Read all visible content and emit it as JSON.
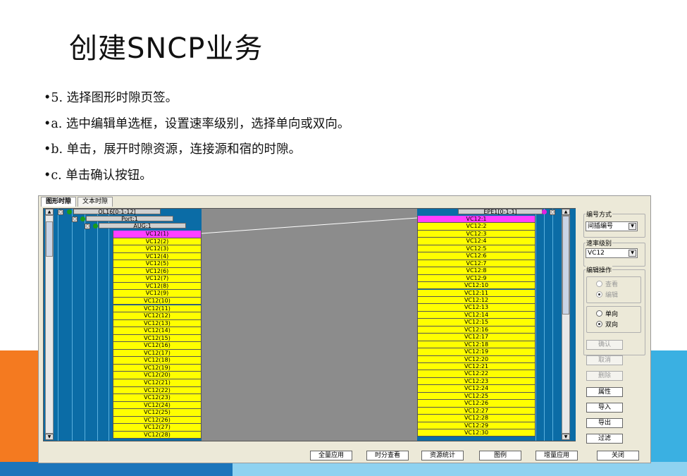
{
  "slide": {
    "title": "创建SNCP业务",
    "bullets": [
      "•5. 选择图形时隙页签。",
      "•a. 选中编辑单选框，设置速率级别，选择单向或双向。",
      "•b. 单击，展开时隙资源，连接源和宿的时隙。",
      "•c. 单击确认按钮。"
    ]
  },
  "app": {
    "tabs": [
      {
        "label": "图形时隙",
        "active": true
      },
      {
        "label": "文本时隙",
        "active": false
      }
    ],
    "left_tree": {
      "board": "OL16[0-1-12]",
      "port": "Port:1",
      "aug": "AUG:1",
      "slots": [
        "VC12(1)",
        "VC12(2)",
        "VC12(3)",
        "VC12(4)",
        "VC12(5)",
        "VC12(6)",
        "VC12(7)",
        "VC12(8)",
        "VC12(9)",
        "VC12(10)",
        "VC12(11)",
        "VC12(12)",
        "VC12(13)",
        "VC12(14)",
        "VC12(15)",
        "VC12(16)",
        "VC12(17)",
        "VC12(18)",
        "VC12(19)",
        "VC12(20)",
        "VC12(21)",
        "VC12(22)",
        "VC12(23)",
        "VC12(24)",
        "VC12(25)",
        "VC12(26)",
        "VC12(27)",
        "VC12(28)"
      ],
      "selected_index": 0
    },
    "right_tree": {
      "board": "EPE1[0-1-1]",
      "slots": [
        "VC12:1",
        "VC12:2",
        "VC12:3",
        "VC12:4",
        "VC12:5",
        "VC12:6",
        "VC12:7",
        "VC12:8",
        "VC12:9",
        "VC12:10",
        "VC12:11",
        "VC12:12",
        "VC12:13",
        "VC12:14",
        "VC12:15",
        "VC12:16",
        "VC12:17",
        "VC12:18",
        "VC12:19",
        "VC12:20",
        "VC12:21",
        "VC12:22",
        "VC12:23",
        "VC12:24",
        "VC12:25",
        "VC12:26",
        "VC12:27",
        "VC12:28",
        "VC12:29",
        "VC12:30"
      ],
      "selected_index": 0
    },
    "options": {
      "numbering_label": "编号方式",
      "numbering_value": "间插编号",
      "rate_label": "速率级别",
      "rate_value": "VC12",
      "edit_op_label": "编辑操作",
      "view_label": "查看",
      "edit_label": "编辑",
      "uni_label": "单向",
      "bi_label": "双向",
      "confirm": "确认",
      "cancel": "取消",
      "delete": "删除",
      "property": "属性",
      "import": "导入",
      "export": "导出",
      "filter": "过滤"
    },
    "bottom_buttons": [
      "全量应用",
      "时分查看",
      "资源统计",
      "图例",
      "增量应用",
      "关闭"
    ],
    "colors": {
      "panel": "#0b6ca6",
      "slot": "#ffff00",
      "selected_slot": "#ff40ff",
      "orange_deco": "#f47a20",
      "blue_deco": "#3ab0e2"
    }
  }
}
